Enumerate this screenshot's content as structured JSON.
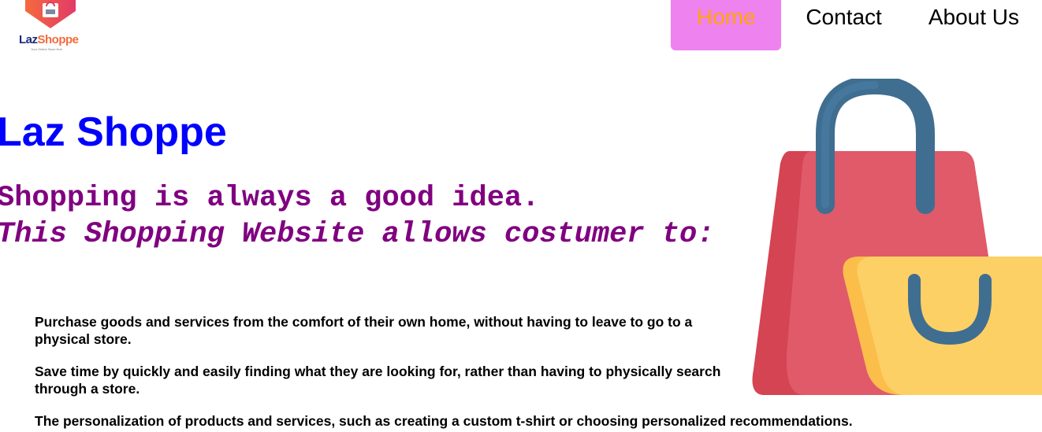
{
  "brand": {
    "logo_text_main": "Laz",
    "logo_text_accent": "Shoppe",
    "logo_tagline": "Your Online Store Hub",
    "logo_icon": "shopping-bag-logo-icon",
    "colors": {
      "logo_orange": "#f46a3c",
      "logo_red": "#e23a68",
      "logo_navy": "#1b2a7a"
    }
  },
  "nav": {
    "items": [
      {
        "label": "Home",
        "active": true
      },
      {
        "label": "Contact",
        "active": false
      },
      {
        "label": "About Us",
        "active": false
      }
    ],
    "colors": {
      "active_bg": "#ee82ee",
      "active_text": "#ffa500",
      "text": "#000000"
    }
  },
  "hero": {
    "title": "Laz Shoppe",
    "tagline": "Shopping is always a good idea.",
    "subline": "This Shopping Website allows costumer to:",
    "colors": {
      "title": "#0000ff",
      "tagline": "#800080"
    }
  },
  "benefits": [
    "Purchase goods and services from the comfort of their own home, without having to leave to go to a physical store.",
    "Save time by quickly and easily finding what they are looking for, rather than having to physically search through a store.",
    "The personalization of products and services, such as creating a custom t-shirt or choosing personalized recommendations."
  ],
  "illustration": {
    "icon": "shopping-bags-icon",
    "colors": {
      "red_bag": "#e05a6a",
      "red_shade": "#d44452",
      "yellow_bag": "#fdd065",
      "yellow_shade": "#fbbe4b",
      "handle": "#3f6e91"
    }
  }
}
